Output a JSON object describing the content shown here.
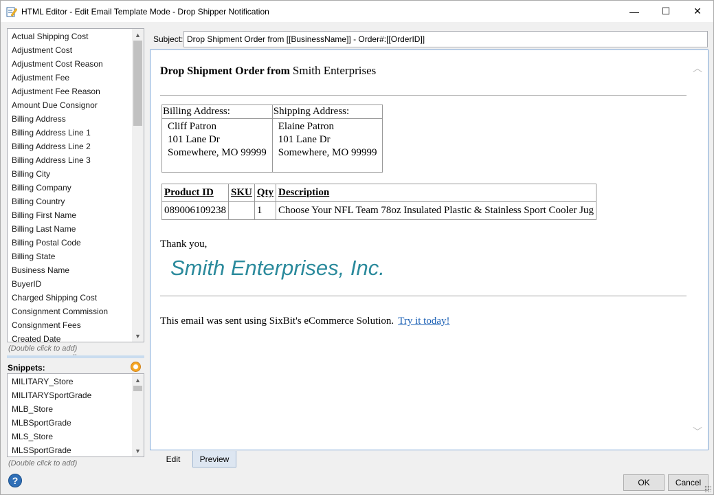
{
  "window": {
    "title": "HTML Editor - Edit Email Template Mode - Drop Shipper Notification",
    "minimize_glyph": "—",
    "maximize_glyph": "☐",
    "close_glyph": "✕"
  },
  "fields": {
    "items": [
      "Actual Shipping Cost",
      "Adjustment Cost",
      "Adjustment Cost Reason",
      "Adjustment Fee",
      "Adjustment Fee Reason",
      "Amount Due Consignor",
      "Billing Address",
      "Billing Address Line 1",
      "Billing Address Line 2",
      "Billing Address Line 3",
      "Billing City",
      "Billing Company",
      "Billing Country",
      "Billing First Name",
      "Billing Last Name",
      "Billing Postal Code",
      "Billing State",
      "Business Name",
      "BuyerID",
      "Charged Shipping Cost",
      "Consignment Commission",
      "Consignment Fees",
      "Created Date"
    ],
    "hint": "(Double click to add)"
  },
  "snippets": {
    "label": "Snippets:",
    "items": [
      "MILITARY_Store",
      "MILITARYSportGrade",
      "MLB_Store",
      "MLBSportGrade",
      "MLS_Store",
      "MLSSportGrade"
    ],
    "hint": "(Double click to add)"
  },
  "subject": {
    "label": "Subject:",
    "value": "Drop Shipment Order from [[BusinessName]] - Order#:[[OrderID]]"
  },
  "document": {
    "heading_bold": "Drop Shipment Order from",
    "heading_business": "Smith Enterprises",
    "billing_label": "Billing Address:",
    "shipping_label": "Shipping Address:",
    "billing": [
      "Cliff Patron",
      "101 Lane Dr",
      "Somewhere, MO 99999"
    ],
    "shipping": [
      "Elaine Patron",
      "101 Lane Dr",
      "Somewhere, MO 99999"
    ],
    "product_headers": [
      "Product ID",
      "SKU",
      "Qty",
      "Description"
    ],
    "product_row": [
      "089006109238",
      "",
      "1",
      "Choose Your NFL Team 78oz Insulated Plastic & Stainless Sport Cooler Jug"
    ],
    "thanks": "Thank you,",
    "logo": "Smith Enterprises, Inc.",
    "footer": "This email was sent using SixBit's eCommerce Solution.",
    "footer_link": "Try it today!"
  },
  "tabs": {
    "edit": "Edit",
    "preview": "Preview"
  },
  "buttons": {
    "ok": "OK",
    "cancel": "Cancel",
    "help": "?"
  }
}
